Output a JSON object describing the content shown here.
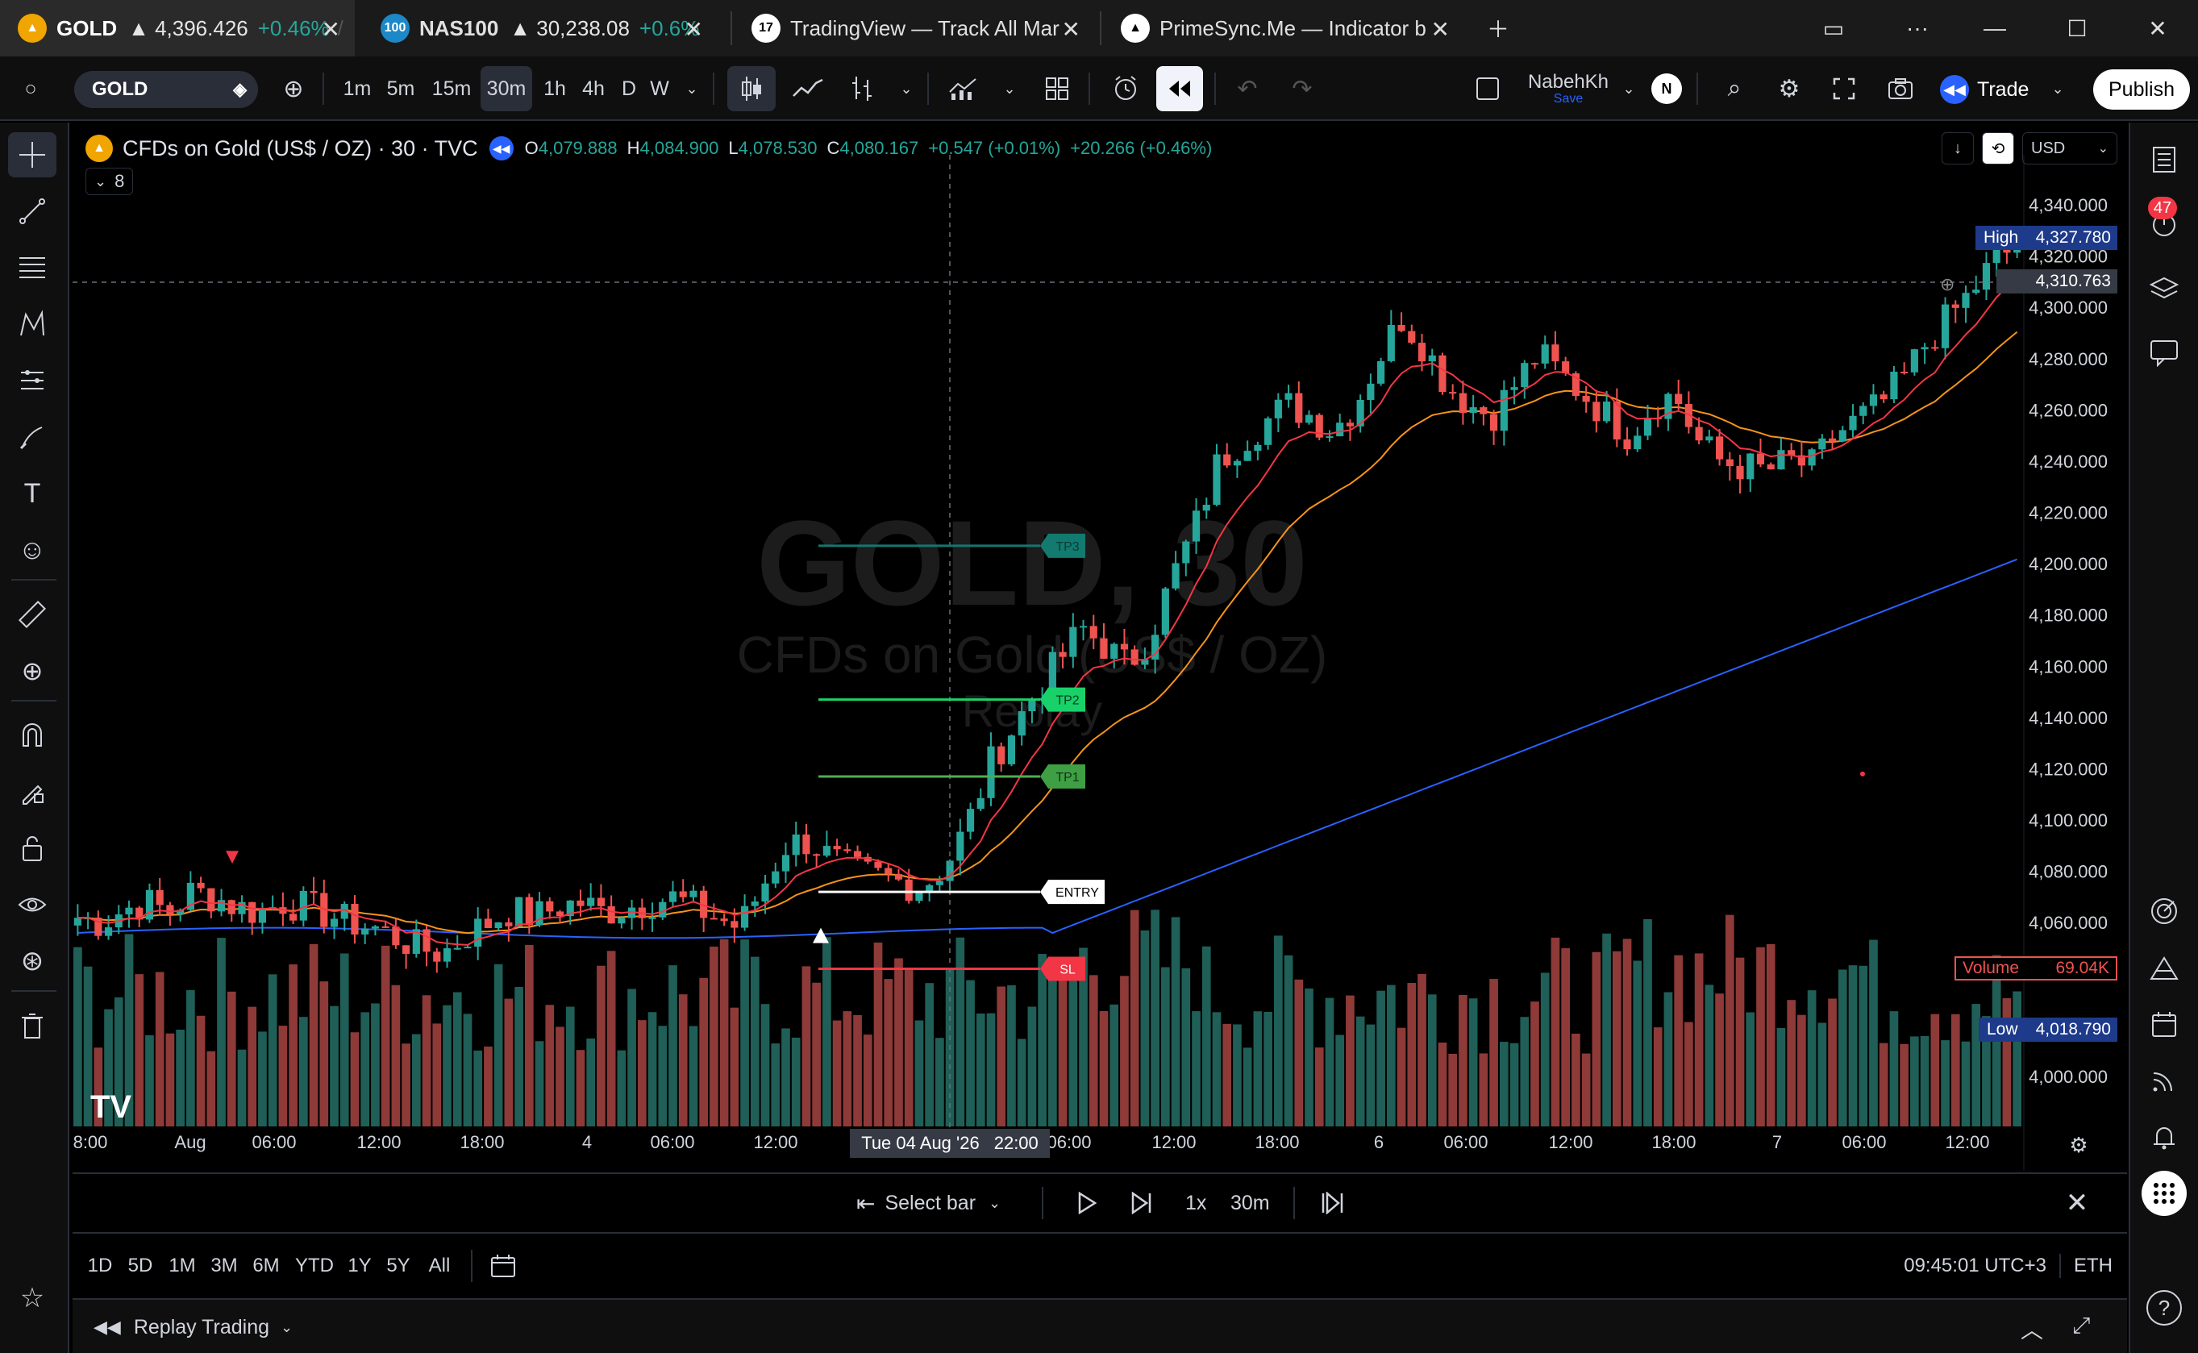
{
  "tabs": [
    {
      "symbol": "GOLD",
      "arrow": "▲",
      "price": "4,396.426",
      "change": "+0.46%",
      "sep": "/",
      "icon_text": "",
      "icon_color": "#f0a500",
      "active": true
    },
    {
      "symbol": "NAS100",
      "arrow": "▲",
      "price": "30,238.08",
      "change": "+0.6%",
      "sep": "",
      "icon_text": "100",
      "icon_color": "#1d88c7",
      "active": false
    },
    {
      "title": "TradingView — Track All Mar",
      "icon_text": "17",
      "icon_color": "#ffffff",
      "active": false
    },
    {
      "title": "PrimeSync.Me — Indicator b",
      "icon_text": "",
      "icon_color": "#ffffff",
      "active": false
    }
  ],
  "toolbar": {
    "symbol": "GOLD",
    "intervals": [
      "1m",
      "5m",
      "15m",
      "30m",
      "1h",
      "4h",
      "D",
      "W"
    ],
    "selected_interval": "30m",
    "user_name": "NabehKh",
    "user_status": "Save",
    "avatar_letter": "N",
    "trade_label": "Trade",
    "publish_label": "Publish"
  },
  "legend": {
    "title": "CFDs on Gold (US$ / OZ) · 30 · TVC",
    "ohlc": [
      {
        "k": "O",
        "v": "4,079.888"
      },
      {
        "k": "H",
        "v": "4,084.900"
      },
      {
        "k": "L",
        "v": "4,078.530"
      },
      {
        "k": "C",
        "v": "4,080.167"
      }
    ],
    "change": "+0.547 (+0.01%)",
    "change2": "+20.266 (+0.46%)",
    "indicator_count": "8"
  },
  "watermark": {
    "symbol": "GOLD, 30",
    "name": "CFDs on Gold (US$ / OZ)",
    "mode": "Replay"
  },
  "price_axis": {
    "currency": "USD",
    "high_label": "High",
    "high_value": "4,327.780",
    "crosshair_value": "4,310.763",
    "volume_label": "Volume",
    "volume_value": "69.04K",
    "low_label": "Low",
    "low_value": "4,018.790"
  },
  "signals": {
    "tp3": "TP3",
    "tp2": "TP2",
    "tp1": "TP1",
    "entry": "ENTRY",
    "sl": "SL"
  },
  "time_axis": {
    "crosshair_label": "Tue 04 Aug '26",
    "crosshair_time": "22:00"
  },
  "replay": {
    "select_bar": "Select bar",
    "speed": "1x",
    "interval": "30m"
  },
  "ranges": [
    "1D",
    "5D",
    "1M",
    "3M",
    "6M",
    "YTD",
    "1Y",
    "5Y",
    "All"
  ],
  "status": {
    "clock": "09:45:01 UTC+3",
    "session": "ETH"
  },
  "bottom": {
    "replay_trading": "Replay Trading"
  },
  "notifications": {
    "count": "47"
  },
  "colors": {
    "up": "#26a69a",
    "down": "#ef5350",
    "ema_fast": "#f23645",
    "ema_slow": "#f7931a",
    "ema_long": "#2962ff",
    "accent": "#2962ff"
  },
  "chart_data": {
    "type": "candlestick",
    "symbol": "CFDs on Gold (US$ / OZ)",
    "interval": "30",
    "y_ticks": [
      4000,
      4020,
      4040,
      4060,
      4080,
      4100,
      4120,
      4140,
      4160,
      4180,
      4200,
      4220,
      4240,
      4260,
      4280,
      4300,
      4320,
      4340
    ],
    "y_ticks_shown": [
      "4,340.000",
      "4,320.000",
      "4,300.000",
      "4,280.000",
      "4,260.000",
      "4,240.000",
      "4,220.000",
      "4,200.000",
      "4,180.000",
      "4,160.000",
      "4,140.000",
      "4,120.000",
      "4,100.000",
      "4,080.000",
      "4,060.000",
      "4,000.000"
    ],
    "x_ticks": [
      "8:00",
      "Aug",
      "06:00",
      "12:00",
      "18:00",
      "4",
      "06:00",
      "12:00",
      "06:00",
      "12:00",
      "18:00",
      "6",
      "06:00",
      "12:00",
      "18:00",
      "7",
      "06:00",
      "12:00"
    ],
    "close_path": [
      4062,
      4060,
      4065,
      4068,
      4064,
      4072,
      4070,
      4066,
      4064,
      4068,
      4066,
      4063,
      4060,
      4058,
      4054,
      4050,
      4048,
      4055,
      4060,
      4065,
      4062,
      4066,
      4068,
      4064,
      4066,
      4068,
      4070,
      4066,
      4062,
      4058,
      4074,
      4090,
      4092,
      4085,
      4080,
      4078,
      4076,
      4074,
      4082,
      4098,
      4122,
      4136,
      4150,
      4162,
      4175,
      4168,
      4160,
      4172,
      4195,
      4215,
      4240,
      4248,
      4255,
      4262,
      4258,
      4252,
      4262,
      4280,
      4296,
      4285,
      4270,
      4262,
      4258,
      4270,
      4282,
      4274,
      4266,
      4258,
      4250,
      4262,
      4266,
      4248,
      4240,
      4238,
      4236,
      4240,
      4238,
      4250,
      4256,
      4262,
      4272,
      4286,
      4296,
      4306,
      4318,
      4324
    ],
    "series": [
      {
        "name": "",
        "role": "ema_fast"
      },
      {
        "name": "",
        "role": "ema_slow"
      },
      {
        "name": "",
        "role": "ema_long"
      }
    ]
  }
}
